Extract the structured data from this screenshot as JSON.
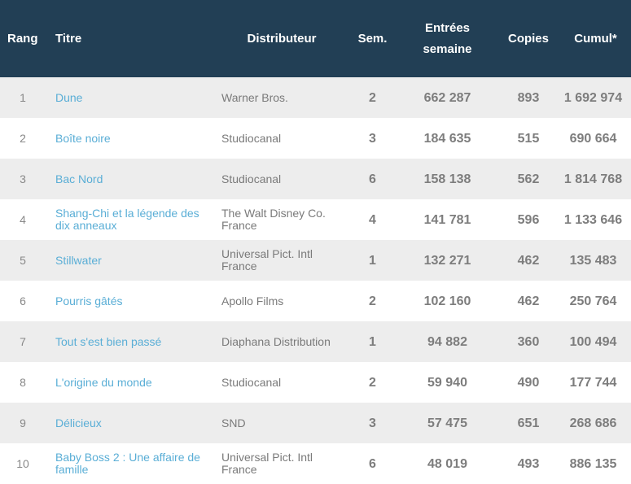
{
  "table": {
    "headers": {
      "rang": "Rang",
      "titre": "Titre",
      "distributeur": "Distributeur",
      "semaines": "Sem.",
      "entrees_line1": "Entrées",
      "entrees_line2": "semaine",
      "copies": "Copies",
      "cumul": "Cumul*"
    },
    "rows": [
      {
        "rang": "1",
        "titre": "Dune",
        "distributeur": "Warner Bros.",
        "semaines": "2",
        "entrees": "662 287",
        "copies": "893",
        "cumul": "1 692 974"
      },
      {
        "rang": "2",
        "titre": "Boîte noire",
        "distributeur": "Studiocanal",
        "semaines": "3",
        "entrees": "184 635",
        "copies": "515",
        "cumul": "690 664"
      },
      {
        "rang": "3",
        "titre": "Bac Nord",
        "distributeur": "Studiocanal",
        "semaines": "6",
        "entrees": "158 138",
        "copies": "562",
        "cumul": "1 814 768"
      },
      {
        "rang": "4",
        "titre": "Shang-Chi et la légende des dix anneaux",
        "distributeur": "The Walt Disney Co. France",
        "semaines": "4",
        "entrees": "141 781",
        "copies": "596",
        "cumul": "1 133 646"
      },
      {
        "rang": "5",
        "titre": "Stillwater",
        "distributeur": "Universal Pict. Intl France",
        "semaines": "1",
        "entrees": "132 271",
        "copies": "462",
        "cumul": "135 483"
      },
      {
        "rang": "6",
        "titre": "Pourris gâtés",
        "distributeur": "Apollo Films",
        "semaines": "2",
        "entrees": "102 160",
        "copies": "462",
        "cumul": "250 764"
      },
      {
        "rang": "7",
        "titre": "Tout s'est bien passé",
        "distributeur": "Diaphana Distribution",
        "semaines": "1",
        "entrees": "94 882",
        "copies": "360",
        "cumul": "100 494"
      },
      {
        "rang": "8",
        "titre": "L'origine du monde",
        "distributeur": "Studiocanal",
        "semaines": "2",
        "entrees": "59 940",
        "copies": "490",
        "cumul": "177 744"
      },
      {
        "rang": "9",
        "titre": "Délicieux",
        "distributeur": "SND",
        "semaines": "3",
        "entrees": "57 475",
        "copies": "651",
        "cumul": "268 686"
      },
      {
        "rang": "10",
        "titre": "Baby Boss 2 : Une affaire de famille",
        "distributeur": "Universal Pict. Intl France",
        "semaines": "6",
        "entrees": "48 019",
        "copies": "493",
        "cumul": "886 135"
      }
    ]
  },
  "colors": {
    "header_bg": "#223f55",
    "link": "#5aaed6",
    "row_alt": "#ededed"
  }
}
